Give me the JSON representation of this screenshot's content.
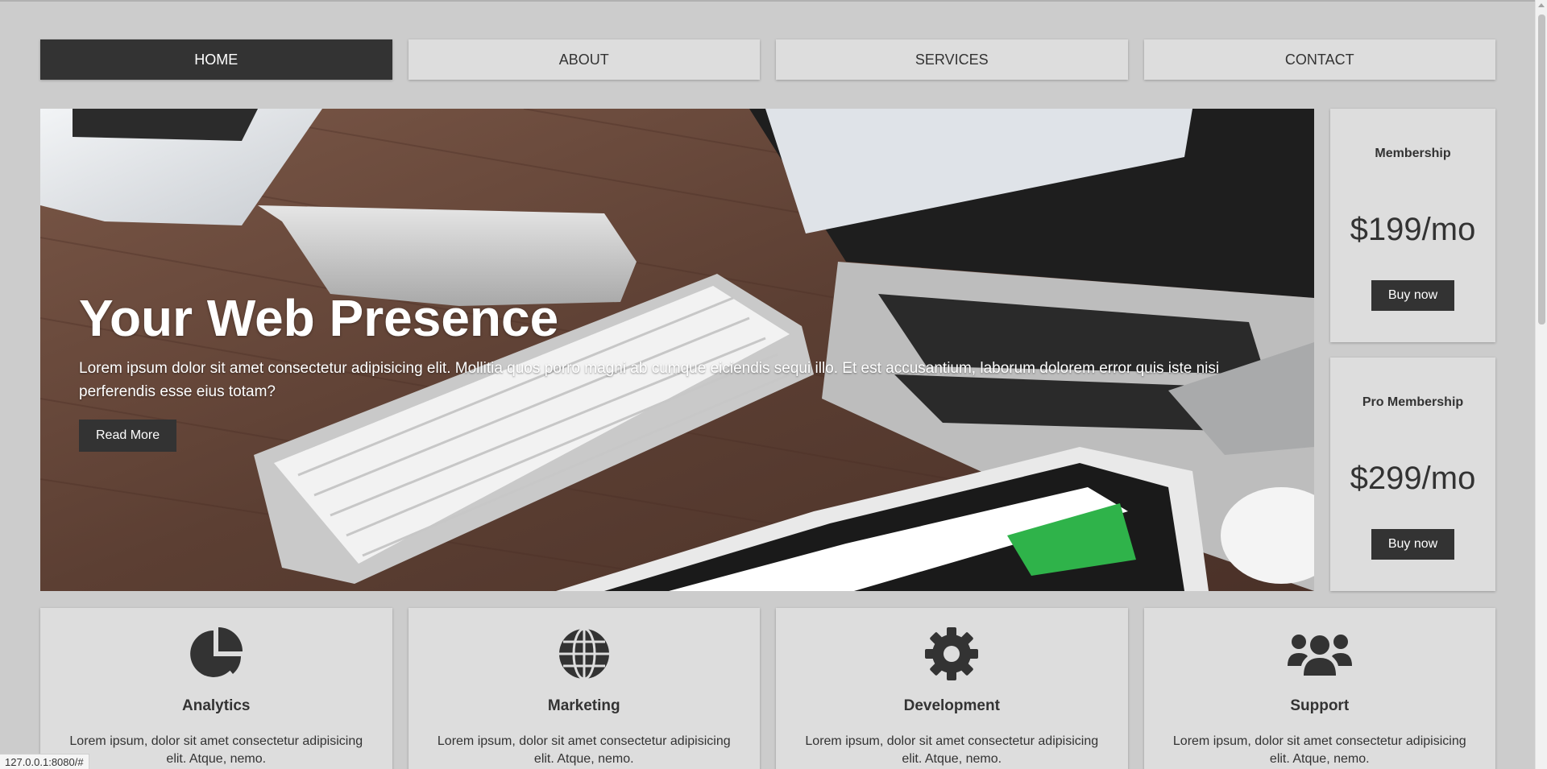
{
  "nav": {
    "items": [
      {
        "label": "HOME",
        "active": true
      },
      {
        "label": "ABOUT",
        "active": false
      },
      {
        "label": "SERVICES",
        "active": false
      },
      {
        "label": "CONTACT",
        "active": false
      }
    ]
  },
  "hero": {
    "title": "Your Web Presence",
    "text": "Lorem ipsum dolor sit amet consectetur adipisicing elit. Mollitia quos porro magni ab cumque eiciendis sequi illo. Et est accusantium, laborum dolorem error quis iste nisi perferendis esse eius totam?",
    "button": "Read More",
    "image": "desk-with-laptop-keyboard-tablet"
  },
  "pricing": [
    {
      "title": "Membership",
      "price": "$199/mo",
      "button": "Buy now"
    },
    {
      "title": "Pro Membership",
      "price": "$299/mo",
      "button": "Buy now"
    }
  ],
  "services": [
    {
      "icon": "chart-pie-icon",
      "title": "Analytics",
      "text": "Lorem ipsum, dolor sit amet consectetur adipisicing elit. Atque, nemo."
    },
    {
      "icon": "globe-icon",
      "title": "Marketing",
      "text": "Lorem ipsum, dolor sit amet consectetur adipisicing elit. Atque, nemo."
    },
    {
      "icon": "cog-icon",
      "title": "Development",
      "text": "Lorem ipsum, dolor sit amet consectetur adipisicing elit. Atque, nemo."
    },
    {
      "icon": "users-icon",
      "title": "Support",
      "text": "Lorem ipsum, dolor sit amet consectetur adipisicing elit. Atque, nemo."
    }
  ],
  "status_bar": {
    "url": "127.0.0.1:8080/#"
  },
  "colors": {
    "dark": "#333333",
    "card": "#dddddd",
    "background": "#cccccc"
  }
}
